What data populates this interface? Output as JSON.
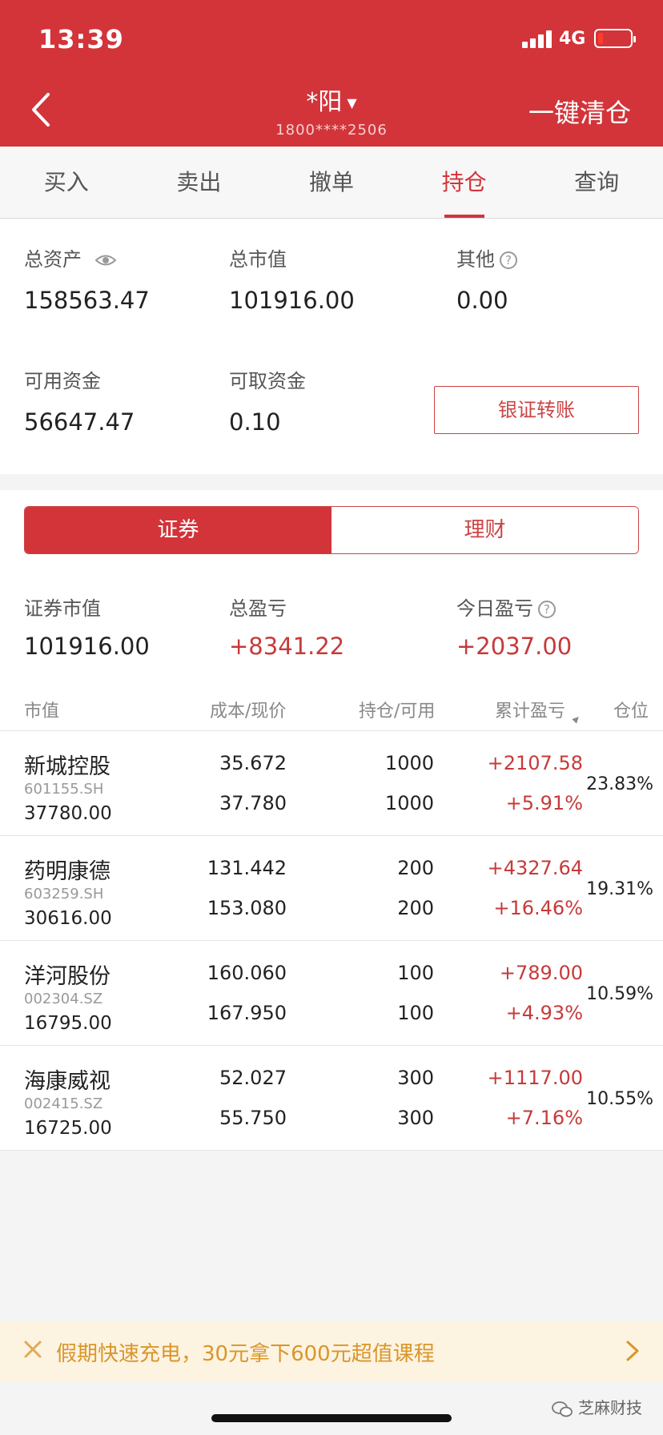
{
  "status_bar": {
    "time": "13:39",
    "network": "4G"
  },
  "header": {
    "account_name": "*阳",
    "account_phone": "1800****2506",
    "clear_all_label": "一键清仓"
  },
  "tabs": [
    {
      "label": "买入"
    },
    {
      "label": "卖出"
    },
    {
      "label": "撤单"
    },
    {
      "label": "持仓",
      "active": true
    },
    {
      "label": "查询"
    }
  ],
  "assets": {
    "total_assets_label": "总资产",
    "total_assets_value": "158563.47",
    "market_value_label": "总市值",
    "market_value_value": "101916.00",
    "other_label": "其他",
    "other_value": "0.00",
    "available_label": "可用资金",
    "available_value": "56647.47",
    "withdrawable_label": "可取资金",
    "withdrawable_value": "0.10",
    "transfer_button": "银证转账"
  },
  "segment": {
    "left": "证券",
    "right": "理财"
  },
  "summary": {
    "sec_value_label": "证券市值",
    "sec_value": "101916.00",
    "total_pl_label": "总盈亏",
    "total_pl": "+8341.22",
    "today_pl_label": "今日盈亏",
    "today_pl": "+2037.00"
  },
  "columns": [
    "市值",
    "成本/现价",
    "持仓/可用",
    "累计盈亏",
    "仓位"
  ],
  "positions": [
    {
      "name": "新城控股",
      "code": "601155.SH",
      "market_value": "37780.00",
      "cost": "35.672",
      "price": "37.780",
      "hold": "1000",
      "avail": "1000",
      "pl": "+2107.58",
      "pl_pct": "+5.91%",
      "weight": "23.83%"
    },
    {
      "name": "药明康德",
      "code": "603259.SH",
      "market_value": "30616.00",
      "cost": "131.442",
      "price": "153.080",
      "hold": "200",
      "avail": "200",
      "pl": "+4327.64",
      "pl_pct": "+16.46%",
      "weight": "19.31%"
    },
    {
      "name": "洋河股份",
      "code": "002304.SZ",
      "market_value": "16795.00",
      "cost": "160.060",
      "price": "167.950",
      "hold": "100",
      "avail": "100",
      "pl": "+789.00",
      "pl_pct": "+4.93%",
      "weight": "10.59%"
    },
    {
      "name": "海康威视",
      "code": "002415.SZ",
      "market_value": "16725.00",
      "cost": "52.027",
      "price": "55.750",
      "hold": "300",
      "avail": "300",
      "pl": "+1117.00",
      "pl_pct": "+7.16%",
      "weight": "10.55%"
    }
  ],
  "banner": {
    "text": "假期快速充电，30元拿下600元超值课程"
  },
  "watermark": "芝麻财技",
  "colors": {
    "brand_red": "#d2343a",
    "profit_red": "#c73a3a",
    "banner_text": "#d9962a"
  }
}
